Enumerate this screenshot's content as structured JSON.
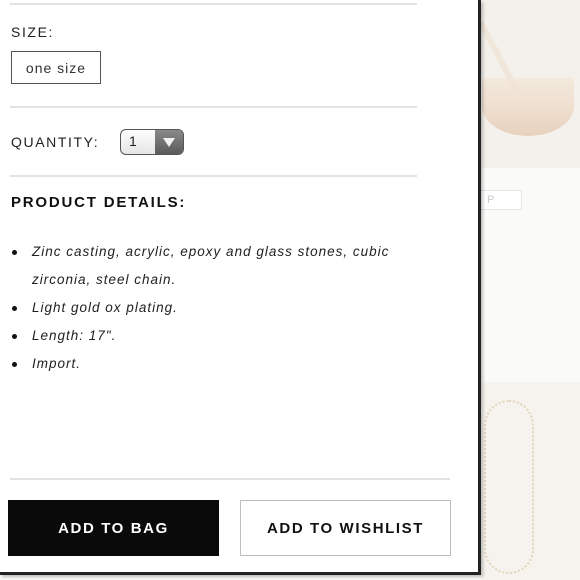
{
  "size": {
    "label": "SIZE:",
    "selected": "one size"
  },
  "quantity": {
    "label": "QUANTITY:",
    "value": "1"
  },
  "product_details": {
    "title": "PRODUCT DETAILS:",
    "items": [
      "Zinc casting, acrylic, epoxy and glass stones, cubic zirconia, steel chain.",
      "Light gold ox plating.",
      "Length: 17\".",
      "Import."
    ]
  },
  "actions": {
    "add_to_bag": "ADD TO BAG",
    "add_to_wishlist": "ADD TO WISHLIST"
  },
  "background": {
    "input_text": "P"
  }
}
